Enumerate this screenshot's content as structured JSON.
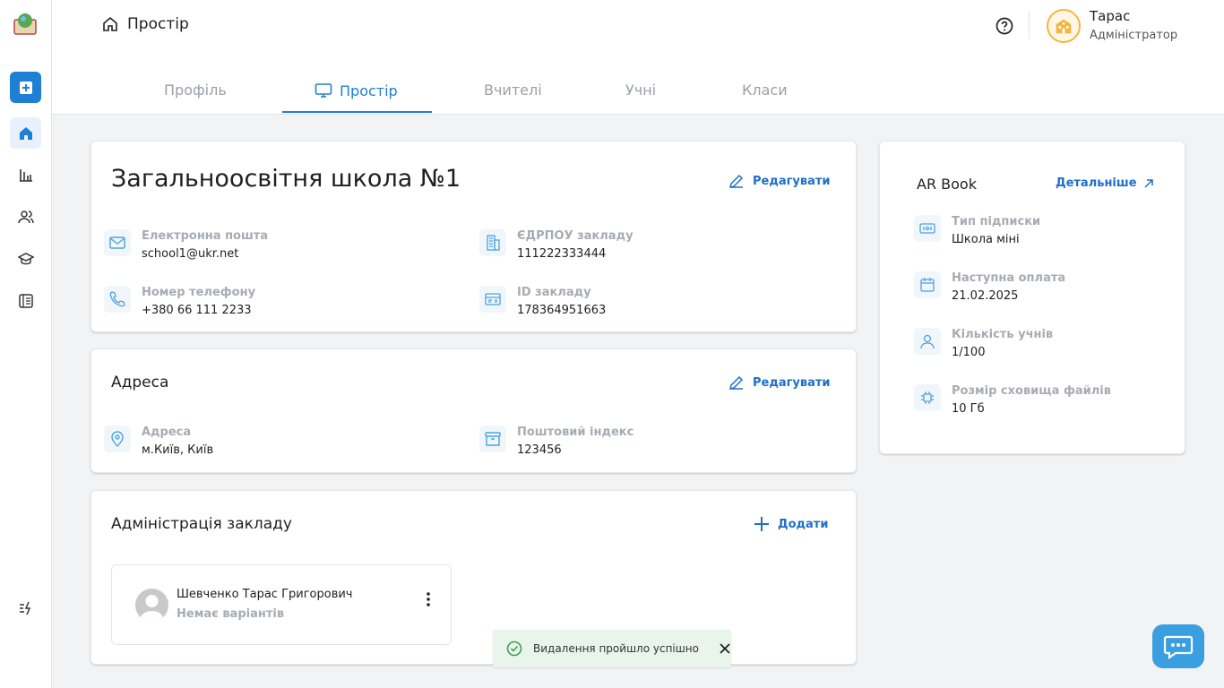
{
  "header": {
    "breadcrumb": "Простір",
    "user_name": "Тарас",
    "user_role": "Адміністратор"
  },
  "tabs": [
    {
      "label": "Профіль"
    },
    {
      "label": "Простір"
    },
    {
      "label": "Вчителі"
    },
    {
      "label": "Учні"
    },
    {
      "label": "Класи"
    }
  ],
  "school": {
    "title": "Загальноосвітня школа №1",
    "edit_label": "Редагувати",
    "email_label": "Електронна пошта",
    "email_value": "school1@ukr.net",
    "edrpou_label": "ЄДРПОУ закладу",
    "edrpou_value": "111222333444",
    "phone_label": "Номер телефону",
    "phone_value": "+380 66 111 2233",
    "id_label": "ID закладу",
    "id_value": "178364951663"
  },
  "address": {
    "title": "Адреса",
    "edit_label": "Редагувати",
    "address_label": "Адреса",
    "address_value": "м.Київ, Київ",
    "zip_label": "Поштовий індекс",
    "zip_value": "123456"
  },
  "administration": {
    "title": "Адміністрація закладу",
    "add_label": "Додати",
    "members": [
      {
        "name": "Шевченко Тарас Григорович",
        "role": "Немає варіантів"
      }
    ]
  },
  "subscription": {
    "title": "AR Book",
    "details_label": "Детальніше",
    "type_label": "Тип підписки",
    "type_value": "Школа міні",
    "next_label": "Наступна оплата",
    "next_value": "21.02.2025",
    "students_label": "Кількість учнів",
    "students_value": "1/100",
    "storage_label": "Розмір сховища файлів",
    "storage_value": "10 Гб"
  },
  "toast": {
    "message": "Видалення пройшло успішно"
  },
  "colors": {
    "accent": "#1f7fd4",
    "toast_bg": "#e9f5ea",
    "success": "#3aa05a"
  }
}
